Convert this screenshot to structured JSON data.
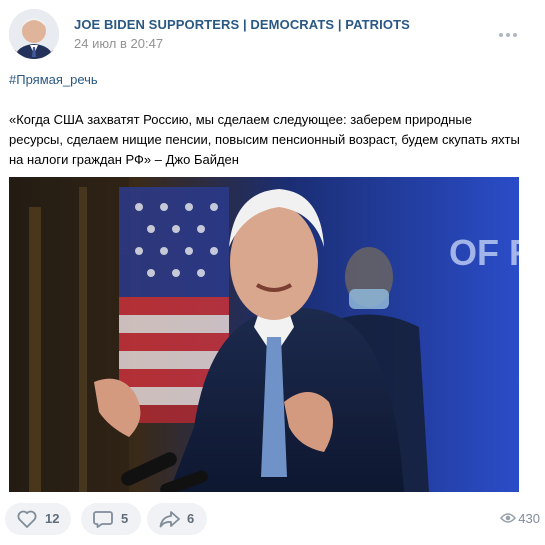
{
  "post": {
    "author": "JOE BIDEN SUPPORTERS | DEMOCRATS | PATRIOTS",
    "date": "24 июл в 20:47",
    "hashtag": "#Прямая_речь",
    "text": "«Когда США захватят Россию, мы сделаем следующее: заберем природные ресурсы, сделаем нищие пенсии, повысим пенсионный возраст, будем скупать яхты на налоги граждан РФ» – Джо Байден",
    "photo_sign_text": "OF RESID"
  },
  "actions": {
    "likes": "12",
    "comments": "5",
    "shares": "6",
    "views": "430"
  },
  "colors": {
    "link": "#2a5885",
    "meta": "#939393",
    "button_bg": "#f0f2f5",
    "button_text": "#626d7a"
  },
  "icons": [
    "avatar",
    "more-icon",
    "heart-icon",
    "comment-icon",
    "share-icon",
    "eye-icon"
  ]
}
